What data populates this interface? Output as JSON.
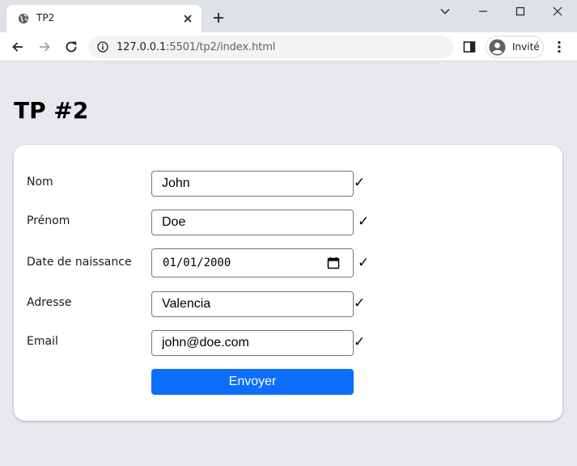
{
  "browser": {
    "tab_title": "TP2",
    "url_host": "127.0.0.1",
    "url_path": ":5501/tp2/index.html",
    "profile_label": "Invité"
  },
  "page": {
    "title": "TP #2"
  },
  "form": {
    "fields": [
      {
        "label": "Nom",
        "value": "John",
        "check": "✓"
      },
      {
        "label": "Prénom",
        "value": "Doe",
        "check": "✓"
      },
      {
        "label": "Date de naissance",
        "value": "01/01/2000",
        "check": "✓"
      },
      {
        "label": "Adresse",
        "value": "Valencia",
        "check": "✓"
      },
      {
        "label": "Email",
        "value": "john@doe.com",
        "check": "✓"
      }
    ],
    "submit_label": "Envoyer"
  },
  "colors": {
    "primary": "#0d6efd",
    "page_background": "#e8e9ec",
    "tabbar_background": "#dee1e6"
  },
  "icons": [
    "globe-icon",
    "close-icon",
    "plus-icon",
    "chevron-down-icon",
    "minimize-icon",
    "maximize-icon",
    "window-close-icon",
    "back-arrow-icon",
    "forward-arrow-icon",
    "reload-icon",
    "info-icon",
    "side-panel-icon",
    "account-icon",
    "more-vert-icon",
    "calendar-icon"
  ]
}
